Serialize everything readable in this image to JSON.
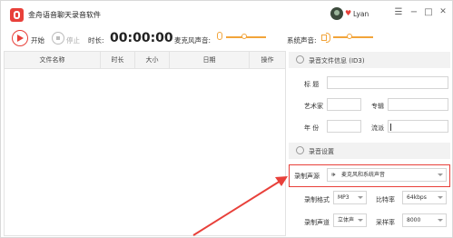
{
  "app": {
    "title": "金舟语音聊天录音软件",
    "user_name": "Lyan",
    "window_controls": {
      "menu": "☰",
      "minimize": "−",
      "maximize": "□",
      "close": "✕"
    }
  },
  "toolbar": {
    "start_label": "开始",
    "stop_label": "停止",
    "duration_label": "时长:",
    "duration_value": "00:00:00",
    "mic_volume_label": "麦克风声音:",
    "system_volume_label": "系统声音:",
    "mic_level": 0.45,
    "system_level": 0.4
  },
  "file_table": {
    "columns": [
      "文件名称",
      "时长",
      "大小",
      "日期",
      "操作"
    ],
    "rows": []
  },
  "id3_section": {
    "title": "录音文件信息 (ID3)",
    "title_label": "标   题",
    "artist_label": "艺术家",
    "album_label": "专辑",
    "year_label": "年   份",
    "genre_label": "流派",
    "title_value": "",
    "artist_value": "",
    "album_value": "",
    "year_value": "",
    "genre_value": ""
  },
  "record_settings": {
    "title": "录音设置",
    "source_label": "录制声源",
    "source_value": "麦克风和系统声音",
    "format_label": "录制格式",
    "format_value": "MP3",
    "bitrate_label": "比特率",
    "bitrate_value": "64kbps",
    "channel_label": "录制声道",
    "channel_value": "立体声",
    "samplerate_label": "采样率",
    "samplerate_value": "8000"
  },
  "colors": {
    "accent": "#e8403a",
    "slider": "#f2a43a"
  }
}
